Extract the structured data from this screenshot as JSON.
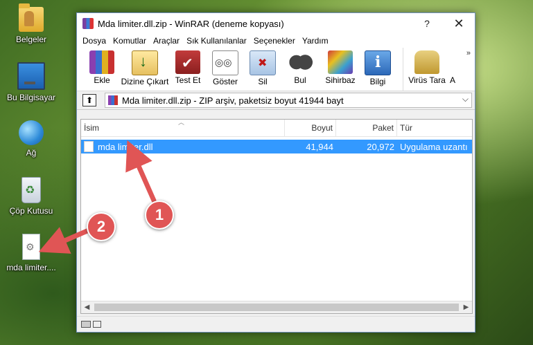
{
  "desktop": {
    "icons": [
      {
        "label": "Belgeler",
        "icon": "folder-icon"
      },
      {
        "label": "Bu Bilgisayar",
        "icon": "computer-icon"
      },
      {
        "label": "Ağ",
        "icon": "network-icon"
      },
      {
        "label": "Çöp Kutusu",
        "icon": "recycle-bin-icon"
      },
      {
        "label": "mda limiter....",
        "icon": "dll-file-icon"
      }
    ]
  },
  "window": {
    "title": "Mda limiter.dll.zip - WinRAR (deneme kopyası)",
    "help_glyph": "?",
    "close_glyph": "✕",
    "menu": [
      "Dosya",
      "Komutlar",
      "Araçlar",
      "Sık Kullanılanlar",
      "Seçenekler",
      "Yardım"
    ],
    "toolbar": [
      {
        "label": "Ekle",
        "icon": "add-archive-icon"
      },
      {
        "label": "Dizine Çıkart",
        "icon": "extract-icon"
      },
      {
        "label": "Test Et",
        "icon": "test-icon"
      },
      {
        "label": "Göster",
        "icon": "view-icon"
      },
      {
        "label": "Sil",
        "icon": "delete-icon"
      },
      {
        "label": "Bul",
        "icon": "find-icon"
      },
      {
        "label": "Sihirbaz",
        "icon": "wizard-icon"
      },
      {
        "label": "Bilgi",
        "icon": "info-icon"
      },
      {
        "label": "Virüs Tara",
        "icon": "virus-scan-icon"
      },
      {
        "label": "A",
        "icon": "truncated-icon"
      }
    ],
    "toolbar_more": "»",
    "address": {
      "up_glyph": "⬆",
      "path": "Mda limiter.dll.zip - ZIP arşiv, paketsiz boyut 41944 bayt",
      "dropdown_glyph": "⌵"
    },
    "columns": {
      "name": "İsim",
      "size": "Boyut",
      "packed": "Paket",
      "type": "Tür"
    },
    "files": [
      {
        "name": "mda limiter.dll",
        "size": "41,944",
        "packed": "20,972",
        "type": "Uygulama uzantı"
      }
    ]
  },
  "annotations": {
    "badge1": "1",
    "badge2": "2",
    "color": "#e05555"
  }
}
